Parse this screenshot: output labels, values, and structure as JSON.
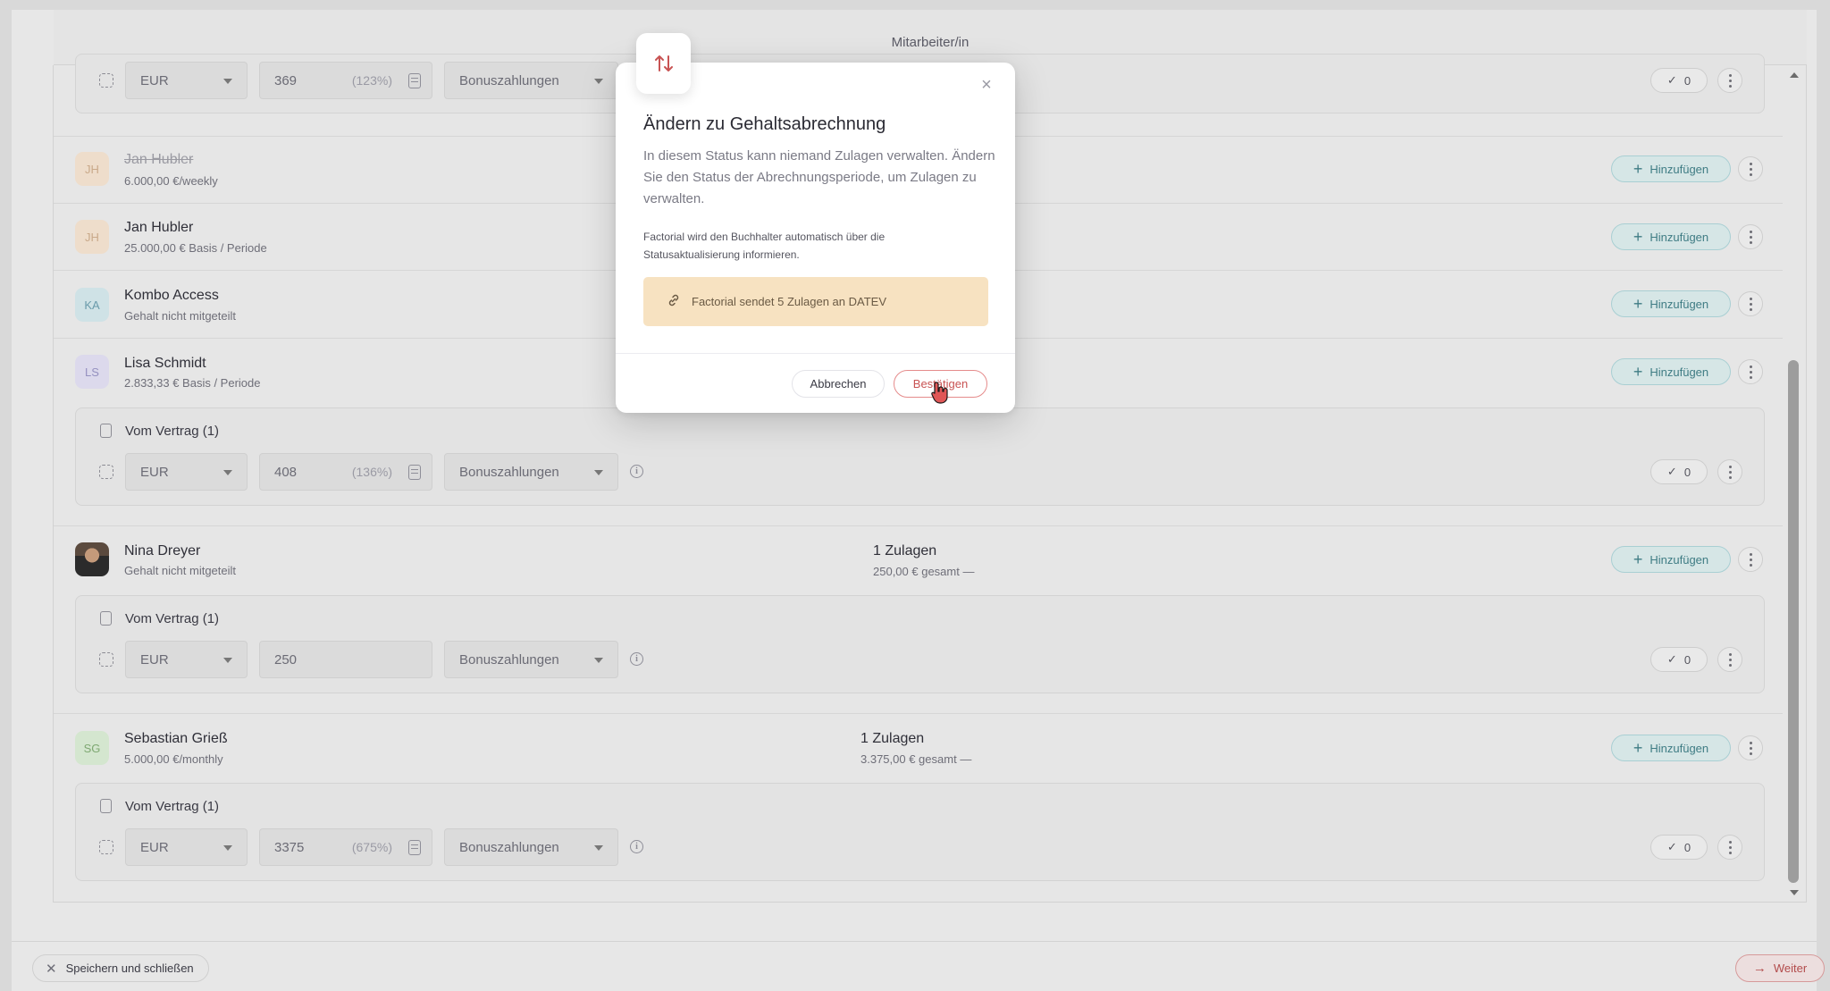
{
  "header": {
    "title": "Mitarbeiter/in"
  },
  "top_contract": {
    "currency": "EUR",
    "amount": "369",
    "percent": "(123%)",
    "category": "Bonuszahlungen",
    "check_count": "0"
  },
  "employees": [
    {
      "initials": "JH",
      "name": "Jan Hubler",
      "sub": "6.000,00 €/weekly",
      "struck": true
    },
    {
      "initials": "JH",
      "name": "Jan Hubler",
      "sub": "25.000,00 € Basis / Periode"
    },
    {
      "initials": "KA",
      "name": "Kombo Access",
      "sub": "Gehalt nicht mitgeteilt"
    },
    {
      "initials": "LS",
      "name": "Lisa Schmidt",
      "sub": "2.833,33 € Basis / Periode",
      "contract": {
        "title": "Vom Vertrag  (1)",
        "currency": "EUR",
        "amount": "408",
        "percent": "(136%)",
        "category": "Bonuszahlungen",
        "check_count": "0"
      }
    },
    {
      "initials": "",
      "name": "Nina Dreyer",
      "sub": "Gehalt nicht mitgeteilt",
      "zulagen": "1 Zulagen",
      "zulagen_sub": "250,00 € gesamt",
      "contract": {
        "title": "Vom Vertrag  (1)",
        "currency": "EUR",
        "amount": "250",
        "category": "Bonuszahlungen",
        "check_count": "0"
      }
    },
    {
      "initials": "SG",
      "name": "Sebastian Grieß",
      "sub": "5.000,00 €/monthly",
      "zulagen": "1 Zulagen",
      "zulagen_sub": "3.375,00 € gesamt",
      "contract": {
        "title": "Vom Vertrag  (1)",
        "currency": "EUR",
        "amount": "3375",
        "percent": "(675%)",
        "category": "Bonuszahlungen",
        "check_count": "0"
      }
    }
  ],
  "add_label": "Hinzufügen",
  "footer": {
    "save_close": "Speichern und schließen",
    "next": "Weiter"
  },
  "modal": {
    "title": "Ändern zu Gehaltsabrechnung",
    "text": "In diesem Status kann niemand Zulagen verwalten. Ändern Sie den Status der Abrechnungsperiode, um Zulagen zu verwalten.",
    "note": "Factorial wird den Buchhalter automatisch über die Statusaktualisierung informieren.",
    "banner": "Factorial sendet 5 Zulagen an DATEV",
    "cancel": "Abbrechen",
    "confirm": "Bestätigen"
  },
  "colors": {
    "accent": "#e58b8b",
    "teal": "#3f7c84",
    "banner": "#f7e2c1"
  },
  "icons": [
    "sort-arrows-icon",
    "close-icon",
    "link-icon",
    "plus-icon",
    "more-vertical-icon",
    "check-icon",
    "info-icon",
    "calculator-icon",
    "document-icon",
    "drag-handle-icon",
    "arrow-right-icon",
    "hand-cursor-icon"
  ]
}
